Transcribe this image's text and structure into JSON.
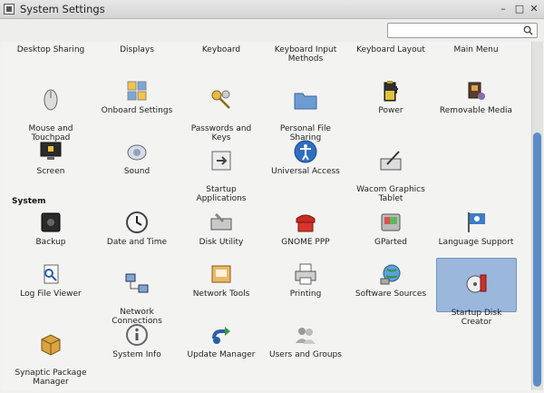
{
  "window": {
    "title": "System Settings",
    "min": "–",
    "max": "□",
    "close": "✕"
  },
  "search": {
    "placeholder": ""
  },
  "top_row": [
    {
      "label": "Desktop Sharing",
      "name": "desktop-sharing"
    },
    {
      "label": "Displays",
      "name": "displays"
    },
    {
      "label": "Keyboard",
      "name": "keyboard"
    },
    {
      "label": "Keyboard Input\nMethods",
      "name": "keyboard-input-methods"
    },
    {
      "label": "Keyboard Layout",
      "name": "keyboard-layout"
    },
    {
      "label": "Main Menu",
      "name": "main-menu"
    }
  ],
  "hardware_row1": [
    {
      "label": "Mouse and\nTouchpad",
      "name": "mouse-touchpad",
      "icon": "mouse-icon"
    },
    {
      "label": "Onboard Settings",
      "name": "onboard-settings",
      "icon": "onboard-icon"
    },
    {
      "label": "Passwords and\nKeys",
      "name": "passwords-keys",
      "icon": "keys-icon"
    },
    {
      "label": "Personal File\nSharing",
      "name": "personal-file-sharing",
      "icon": "folder-icon"
    },
    {
      "label": "Power",
      "name": "power",
      "icon": "battery-icon"
    },
    {
      "label": "Removable Media",
      "name": "removable-media",
      "icon": "media-icon"
    }
  ],
  "hardware_row2": [
    {
      "label": "Screen",
      "name": "screen",
      "icon": "screen-lock-icon"
    },
    {
      "label": "Sound",
      "name": "sound",
      "icon": "speaker-icon"
    },
    {
      "label": "Startup\nApplications",
      "name": "startup-applications",
      "icon": "startup-icon"
    },
    {
      "label": "Universal Access",
      "name": "universal-access",
      "icon": "accessibility-icon"
    },
    {
      "label": "Wacom Graphics\nTablet",
      "name": "wacom-tablet",
      "icon": "tablet-icon"
    }
  ],
  "section_system": "System",
  "system_row1": [
    {
      "label": "Backup",
      "name": "backup",
      "icon": "safe-icon"
    },
    {
      "label": "Date and Time",
      "name": "date-time",
      "icon": "clock-icon"
    },
    {
      "label": "Disk Utility",
      "name": "disk-utility",
      "icon": "disk-icon"
    },
    {
      "label": "GNOME PPP",
      "name": "gnome-ppp",
      "icon": "phone-icon"
    },
    {
      "label": "GParted",
      "name": "gparted",
      "icon": "gparted-icon"
    },
    {
      "label": "Language Support",
      "name": "language-support",
      "icon": "flag-icon"
    }
  ],
  "system_row2": [
    {
      "label": "Log File Viewer",
      "name": "log-file-viewer",
      "icon": "log-icon"
    },
    {
      "label": "Network\nConnections",
      "name": "network-connections",
      "icon": "network-icon"
    },
    {
      "label": "Network Tools",
      "name": "network-tools",
      "icon": "network-tools-icon"
    },
    {
      "label": "Printing",
      "name": "printing",
      "icon": "printer-icon"
    },
    {
      "label": "Software Sources",
      "name": "software-sources",
      "icon": "globe-icon"
    },
    {
      "label": "Startup Disk\nCreator",
      "name": "startup-disk-creator",
      "icon": "disk-creator-icon"
    }
  ],
  "system_row3": [
    {
      "label": "Synaptic Package\nManager",
      "name": "synaptic",
      "icon": "package-icon"
    },
    {
      "label": "System Info",
      "name": "system-info",
      "icon": "info-icon"
    },
    {
      "label": "Update Manager",
      "name": "update-manager",
      "icon": "update-icon"
    },
    {
      "label": "Users and Groups",
      "name": "users-groups",
      "icon": "users-icon"
    }
  ],
  "colors": {
    "accent": "#5a8cc7",
    "selection": "#9bb7db"
  }
}
